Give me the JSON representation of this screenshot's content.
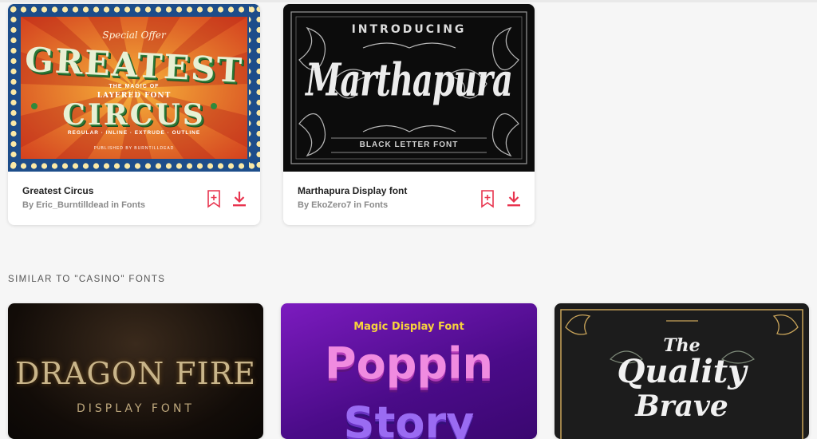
{
  "colors": {
    "accent": "#e8344e",
    "page_bg": "#f6f6f6"
  },
  "cards": [
    {
      "title": "Greatest Circus",
      "meta": "By Eric_Burntilldead in Fonts",
      "image": {
        "top_script": "Special Offer",
        "line1": "GREATEST",
        "small1": "THE MAGIC OF",
        "small2": "LAYERED FONT",
        "line2": "CIRCUS",
        "styles": "REGULAR · INLINE · EXTRUDE · OUTLINE",
        "publisher": "PUBLISHED BY BURNTILLDEAD"
      },
      "icons": [
        "bookmark-add-icon",
        "download-icon"
      ]
    },
    {
      "title": "Marthapura Display font",
      "meta": "By EkoZero7 in Fonts",
      "image": {
        "intro": "INTRODUCING",
        "name": "Marthapura",
        "sub": "BLACK LETTER FONT"
      },
      "icons": [
        "bookmark-add-icon",
        "download-icon"
      ]
    }
  ],
  "similar": {
    "heading": "SIMILAR TO \"CASINO\" FONTS",
    "items": [
      {
        "line1": "DRAGON FIRE",
        "line2": "DISPLAY FONT"
      },
      {
        "tag": "Magic Display Font",
        "line1": "Poppin",
        "line2": "Story"
      },
      {
        "line1": "The",
        "line2": "Quality",
        "line3": "Brave"
      }
    ]
  }
}
